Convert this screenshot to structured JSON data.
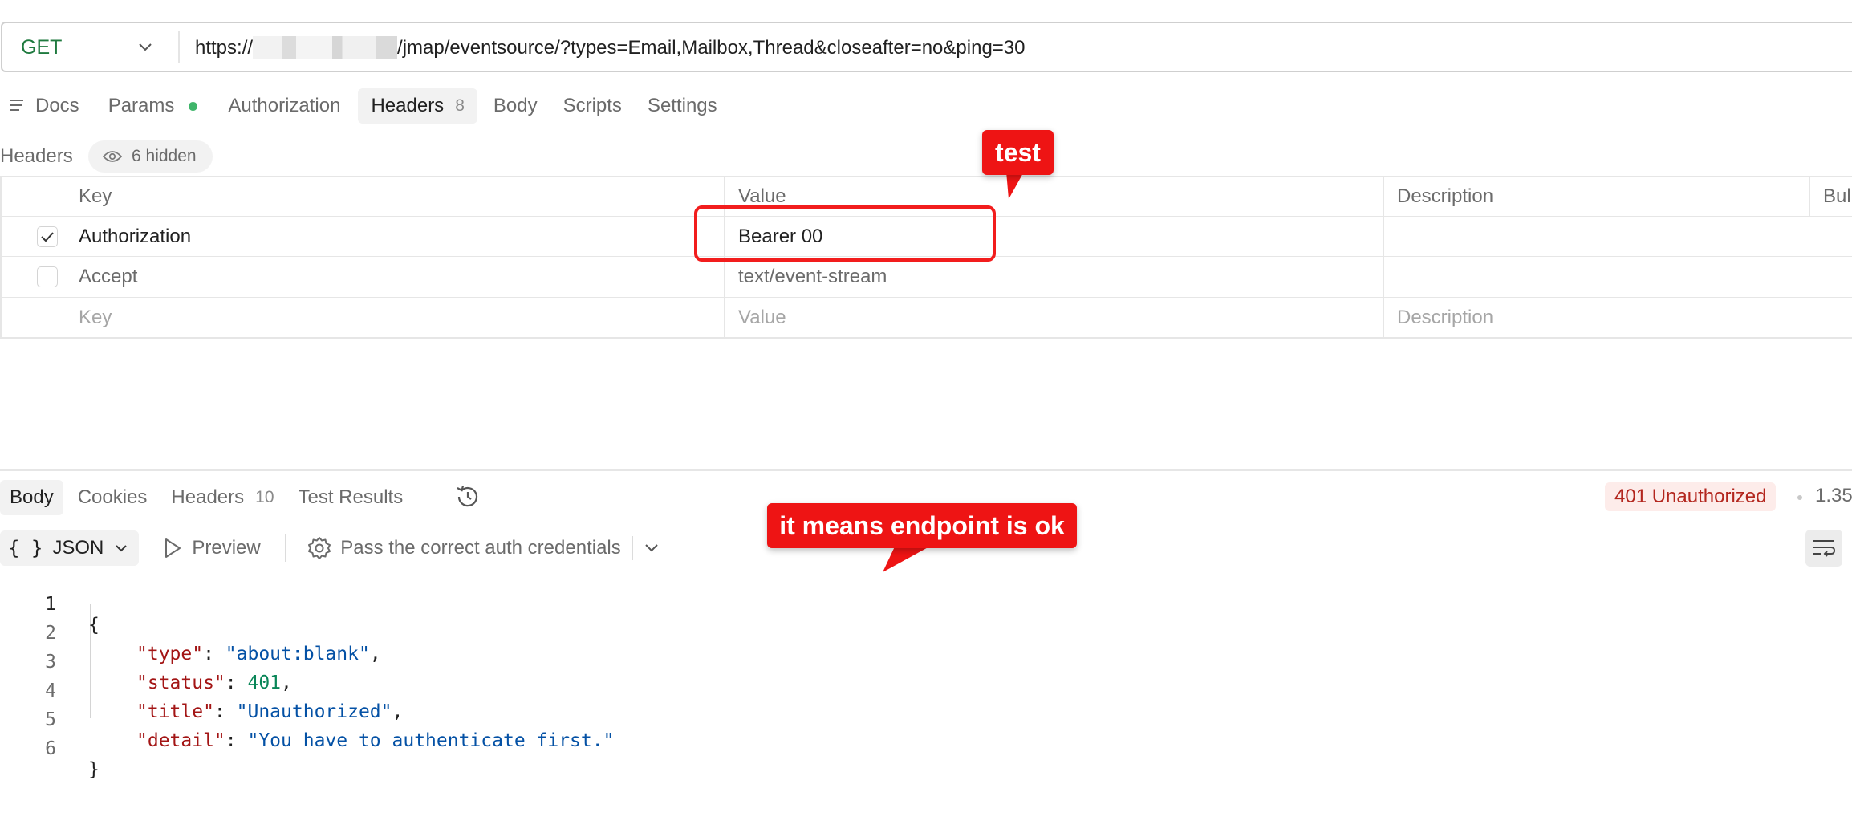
{
  "request": {
    "method": "GET",
    "url_prefix": "https://",
    "url_suffix": "/jmap/eventsource/?types=Email,Mailbox,Thread&closeafter=no&ping=30"
  },
  "request_tabs": {
    "docs": "Docs",
    "params": "Params",
    "authorization": "Authorization",
    "headers": "Headers",
    "headers_count": "8",
    "body": "Body",
    "scripts": "Scripts",
    "settings": "Settings"
  },
  "headers_section": {
    "label": "Headers",
    "hidden": "6 hidden",
    "columns": {
      "key": "Key",
      "value": "Value",
      "description": "Description",
      "bulk": "Bul"
    },
    "rows": [
      {
        "key": "Authorization",
        "value": "Bearer 00",
        "checked": true
      },
      {
        "key": "Accept",
        "value": "text/event-stream",
        "checked": false
      }
    ],
    "placeholders": {
      "key": "Key",
      "value": "Value",
      "description": "Description"
    }
  },
  "annotations": {
    "test": "test",
    "endpoint": "it means endpoint is ok"
  },
  "response_tabs": {
    "body": "Body",
    "cookies": "Cookies",
    "headers": "Headers",
    "headers_count": "10",
    "test_results": "Test Results"
  },
  "response": {
    "status": "401 Unauthorized",
    "time": "1.35",
    "format": "JSON",
    "preview": "Preview",
    "hint": "Pass the correct auth credentials"
  },
  "code": {
    "line_numbers": [
      "1",
      "2",
      "3",
      "4",
      "5",
      "6"
    ],
    "open_brace": "{",
    "close_brace": "}",
    "entries": [
      {
        "key": "\"type\"",
        "value": "\"about:blank\"",
        "kind": "string",
        "trail": ","
      },
      {
        "key": "\"status\"",
        "value": "401",
        "kind": "number",
        "trail": ","
      },
      {
        "key": "\"title\"",
        "value": "\"Unauthorized\"",
        "kind": "string",
        "trail": ","
      },
      {
        "key": "\"detail\"",
        "value": "\"You have to authenticate first.\"",
        "kind": "string",
        "trail": ""
      }
    ]
  },
  "colors": {
    "method_get": "#1f7a3f",
    "params_dot": "#3fb56a",
    "annotation_red": "#ee1414",
    "status_error": "#b3261e"
  }
}
